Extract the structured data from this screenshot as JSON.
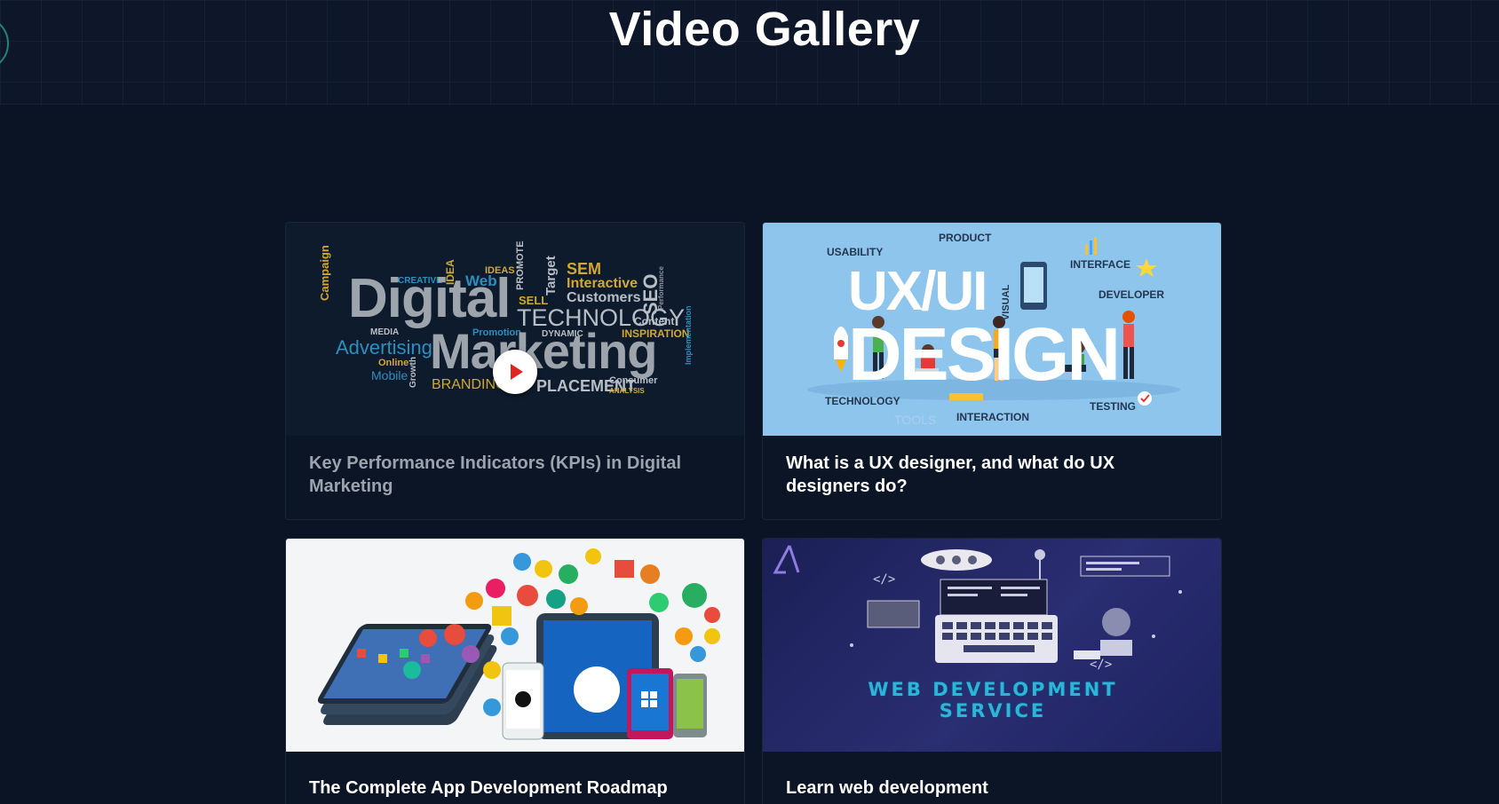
{
  "page": {
    "title": "Video Gallery",
    "background": "#0a1424",
    "accent_ring": "#2a9d8f"
  },
  "videos": [
    {
      "title": "Key Performance Indicators (KPIs) in Digital Marketing",
      "thumbnail": "digital-marketing-word-cloud",
      "state": "dimmed, play button visible",
      "thumb_words": {
        "digital": "Digital",
        "marketing": "Marketing",
        "technology": "TECHNOLOGY",
        "advertising": "Advertising",
        "branding": "BRANDING",
        "placement": "PLACEMENT",
        "seo": "SEO",
        "sem": "SEM",
        "interactive": "Interactive",
        "customers": "Customers",
        "inspiration": "INSPIRATION",
        "content": "Content",
        "web": "Web",
        "ideas": "IDEAS",
        "sell": "SELL",
        "media": "MEDIA",
        "online": "Online",
        "mobile": "Mobile",
        "promotion": "Promotion",
        "dynamic": "DYNAMIC",
        "consumer": "Consumer",
        "analysis": "ANALYSIS",
        "creative": "CREATIVE",
        "campaign": "Campaign",
        "idea": "IDEA",
        "promote": "PROMOTE",
        "target": "Target",
        "growth": "Growth",
        "implementation": "Implementation",
        "performance": "Performance"
      }
    },
    {
      "title": "What is a UX designer, and what do UX designers do?",
      "thumbnail": "ux-ui-design-illustration",
      "thumb_words": {
        "ux_ui": "UX/UI",
        "design": "DESIGN",
        "usability": "USABILITY",
        "product": "PRODUCT",
        "interface": "INTERFACE",
        "developer": "DEVELOPER",
        "technology": "TECHNOLOGY",
        "interaction": "INTERACTION",
        "testing": "TESTING",
        "visual": "VISUAL",
        "tools": "TOOLS"
      }
    },
    {
      "title": "The Complete App Development Roadmap",
      "thumbnail": "app-development-devices-and-icons"
    },
    {
      "title": "Learn web development",
      "thumbnail": "web-development-service",
      "thumb_words": {
        "line1": "WEB DEVELOPMENT",
        "line2": "SERVICE"
      }
    }
  ]
}
